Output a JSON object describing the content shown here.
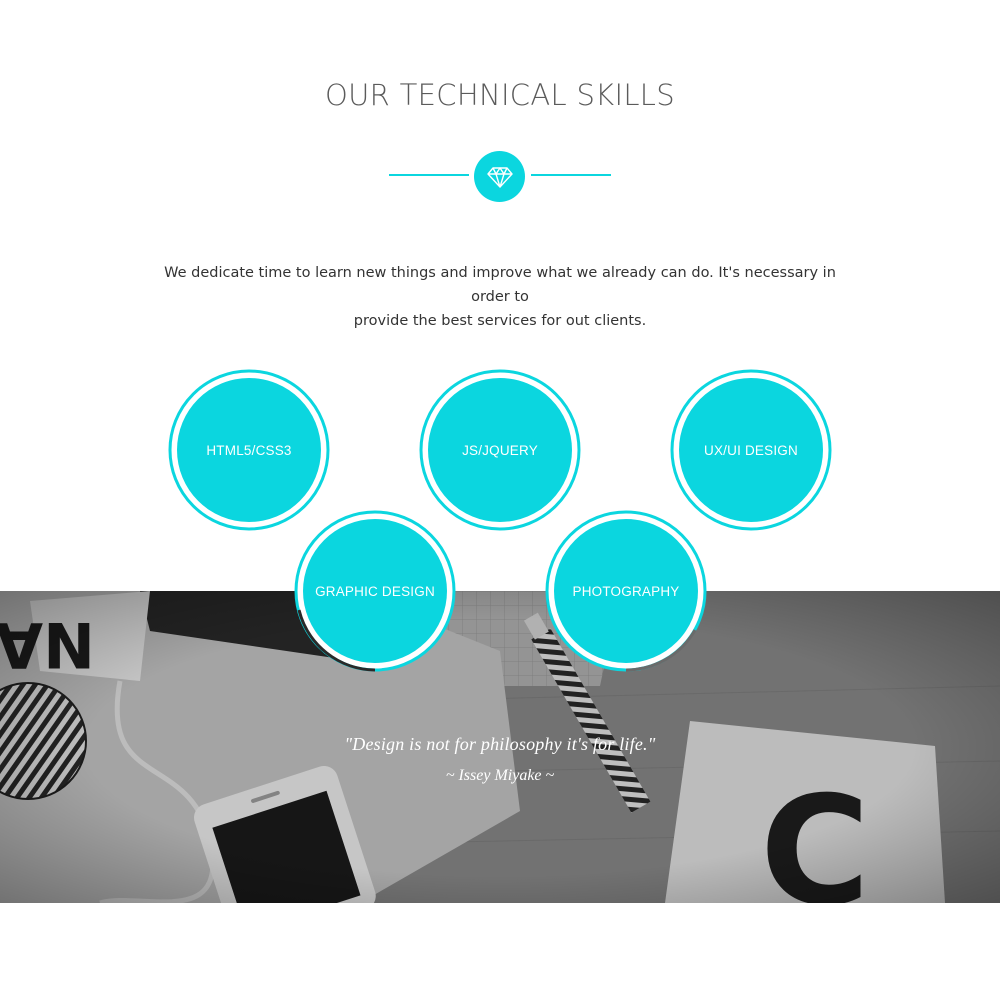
{
  "section": {
    "title": "OUR TECHNICAL SKILLS",
    "divider_icon": "diamond-icon",
    "intro_line1": "We dedicate time to learn new things and improve what we already can do. It's necessary in order to",
    "intro_line2": "provide the best services for out clients."
  },
  "skills": [
    {
      "label": "HTML5/CSS3"
    },
    {
      "label": "JS/JQUERY"
    },
    {
      "label": "UX/UI DESIGN"
    },
    {
      "label": "GRAPHIC DESIGN"
    },
    {
      "label": "PHOTOGRAPHY"
    }
  ],
  "quote": {
    "text": "\"Design is not for philosophy it's for life.\"",
    "author": "~ Issey Miyake ~"
  },
  "colors": {
    "accent": "#0bd6df",
    "title": "#5b5b5b",
    "body_text": "#333333"
  }
}
